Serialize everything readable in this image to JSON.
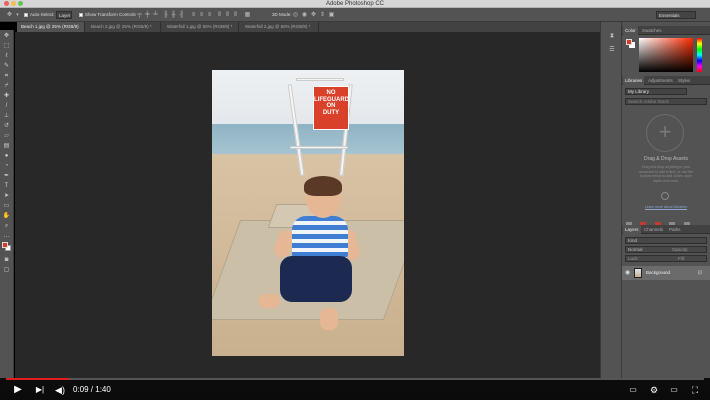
{
  "app": {
    "title": "Adobe Photoshop CC"
  },
  "options_bar": {
    "auto_select_label": "Auto-Select:",
    "auto_select_value": "Layer",
    "show_transform_label": "Show Transform Controls",
    "mode_3d_label": "3D Mode:",
    "workspace_value": "Essentials"
  },
  "document_tabs": [
    {
      "label": "Beach 1.jpg @ 25% (RGB/8)",
      "active": true
    },
    {
      "label": "Beach 2.jpg @ 25% (RGB/8) *",
      "active": false
    },
    {
      "label": "Waterfall 1.jpg @ 50% (RGB/8) *",
      "active": false
    },
    {
      "label": "Waterfall 2.jpg @ 50% (RGB/8) *",
      "active": false
    }
  ],
  "photo": {
    "sign_line1": "NO",
    "sign_line2": "LIFEGUARD",
    "sign_line3": "ON",
    "sign_line4": "DUTY"
  },
  "panels": {
    "color_tabs": [
      "Color",
      "Swatches"
    ],
    "library_tabs": [
      "Libraries",
      "Adjustments",
      "Styles"
    ],
    "library_select": "My Library",
    "library_search_placeholder": "Search Adobe Stock",
    "drag_drop_title": "Drag & Drop Assets",
    "drag_drop_desc": "Drag and drop anything in your document to add it here, or use the buttons below to add colors, layer styles and more.",
    "library_link": "Learn more about Libraries",
    "layers_tabs": [
      "Layers",
      "Channels",
      "Paths"
    ],
    "kind_label": "Kind",
    "blend_mode": "Normal",
    "opacity_label": "Opacity:",
    "lock_label": "Lock:",
    "fill_label": "Fill:",
    "layer_name": "Background"
  },
  "colors": {
    "foreground": "#d63c2b",
    "background": "#ffffff",
    "progress": "#e21c1c",
    "canvas_bg": "#282828",
    "panel_bg": "#535353"
  },
  "video": {
    "time": "0:09 / 1:40",
    "progress_fraction": 0.09,
    "controls": [
      "play-icon",
      "next-icon",
      "volume-icon",
      "subtitles-icon",
      "settings-icon",
      "miniplayer-icon",
      "theater-icon",
      "fullscreen-icon"
    ]
  }
}
